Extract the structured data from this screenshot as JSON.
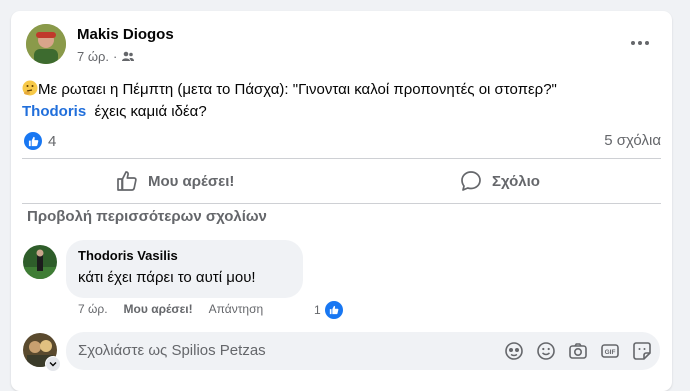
{
  "post": {
    "author": "Makis Diogos",
    "time": "7 ώρ.",
    "separator": "·",
    "audience_icon": "friends-icon",
    "menu_icon": "more-options-icon",
    "text_line1": "Με ρωταει η Πέμπτη (μετα το Πάσχα): \"Γινονται καλοί προπονητές οι στοπερ?\"",
    "mention": "Thodoris",
    "text_line2": "έχεις καμιά ιδέα?",
    "emoji_icon": "thinking-face-emoji",
    "reactions_count": "4",
    "comments_count": "5 σχόλια"
  },
  "actions": {
    "like": "Μου αρέσει!",
    "comment": "Σχόλιο"
  },
  "comments_section": {
    "view_more": "Προβολή περισσότερων σχολίων",
    "comments": [
      {
        "author": "Thodoris Vasilis",
        "text": "κάτι έχει πάρει το αυτί μου!",
        "time": "7 ώρ.",
        "like": "Μου αρέσει!",
        "reply": "Απάντηση",
        "reactions": "1"
      }
    ]
  },
  "composer": {
    "placeholder": "Σχολιάστε ως Spilios Petzas",
    "icons": [
      "avatar-sticker-icon",
      "emoji-icon",
      "camera-icon",
      "gif-icon",
      "sticker-icon"
    ]
  },
  "colors": {
    "accent": "#216fdb",
    "like_blue": "#1877f2",
    "muted": "#65676b",
    "background": "#f0f2f5"
  }
}
